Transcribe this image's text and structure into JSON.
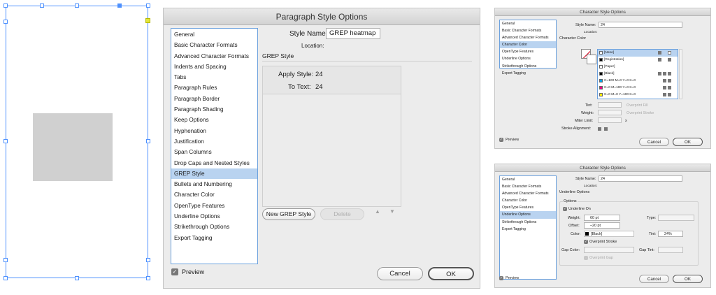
{
  "main_dialog": {
    "title": "Paragraph Style Options",
    "panels": [
      "General",
      "Basic Character Formats",
      "Advanced Character Formats",
      "Indents and Spacing",
      "Tabs",
      "Paragraph Rules",
      "Paragraph Border",
      "Paragraph Shading",
      "Keep Options",
      "Hyphenation",
      "Justification",
      "Span Columns",
      "Drop Caps and Nested Styles",
      "GREP Style",
      "Bullets and Numbering",
      "Character Color",
      "OpenType Features",
      "Underline Options",
      "Strikethrough Options",
      "Export Tagging"
    ],
    "active_panel": "GREP Style",
    "style_name_label": "Style Name:",
    "style_name_value": "GREP heatmap",
    "location_label": "Location:",
    "section_title": "GREP Style",
    "apply_style_label": "Apply Style:",
    "apply_style_value": "24",
    "to_text_label": "To Text:",
    "to_text_value": "24",
    "new_grep_button": "New GREP Style",
    "delete_button": "Delete",
    "preview_label": "Preview",
    "preview_checked": true,
    "cancel_button": "Cancel",
    "ok_button": "OK"
  },
  "char_color_dialog": {
    "title": "Character Style Options",
    "panels": [
      "General",
      "Basic Character Formats",
      "Advanced Character Formats",
      "Character Color",
      "OpenType Features",
      "Underline Options",
      "Strikethrough Options",
      "Export Tagging"
    ],
    "active_panel": "Character Color",
    "style_name_label": "Style Name:",
    "style_name_value": "24",
    "location_label": "Location:",
    "section_title": "Character Color",
    "swatches": [
      {
        "name": "[None]",
        "color": "#ffffff"
      },
      {
        "name": "[Registration]",
        "color": "#000000"
      },
      {
        "name": "[Paper]",
        "color": "#ffffff"
      },
      {
        "name": "[Black]",
        "color": "#000000"
      },
      {
        "name": "C=100 M=0 Y=0 K=0",
        "color": "#00a0e3"
      },
      {
        "name": "C=0 M=100 Y=0 K=0",
        "color": "#e6007e"
      },
      {
        "name": "C=0 M=0 Y=100 K=0",
        "color": "#ffec00"
      }
    ],
    "tint_label": "Tint:",
    "overprint_fill_label": "Overprint Fill",
    "weight_label": "Weight:",
    "overprint_stroke_label": "Overprint Stroke",
    "miter_limit_label": "Miter Limit:",
    "miter_x": "x",
    "stroke_alignment_label": "Stroke Alignment:",
    "preview_label": "Preview",
    "preview_checked": true,
    "cancel_button": "Cancel",
    "ok_button": "OK"
  },
  "underline_dialog": {
    "title": "Character Style Options",
    "panels": [
      "General",
      "Basic Character Formats",
      "Advanced Character Formats",
      "Character Color",
      "OpenType Features",
      "Underline Options",
      "Strikethrough Options",
      "Export Tagging"
    ],
    "active_panel": "Underline Options",
    "style_name_label": "Style Name:",
    "style_name_value": "24",
    "location_label": "Location:",
    "section_title": "Underline Options",
    "options_label": "Options",
    "underline_on_label": "Underline On",
    "underline_on_checked": true,
    "weight_label": "Weight:",
    "weight_value": "60 pt",
    "type_label": "Type:",
    "offset_label": "Offset:",
    "offset_value": "–20 pt",
    "color_label": "Color:",
    "color_value": "[Black]",
    "tint_label": "Tint:",
    "tint_value": "24%",
    "overprint_stroke_label": "Overprint Stroke",
    "gap_color_label": "Gap Color:",
    "gap_tint_label": "Gap Tint:",
    "overprint_gap_label": "Overprint Gap",
    "preview_label": "Preview",
    "preview_checked": true,
    "cancel_button": "Cancel",
    "ok_button": "OK"
  }
}
